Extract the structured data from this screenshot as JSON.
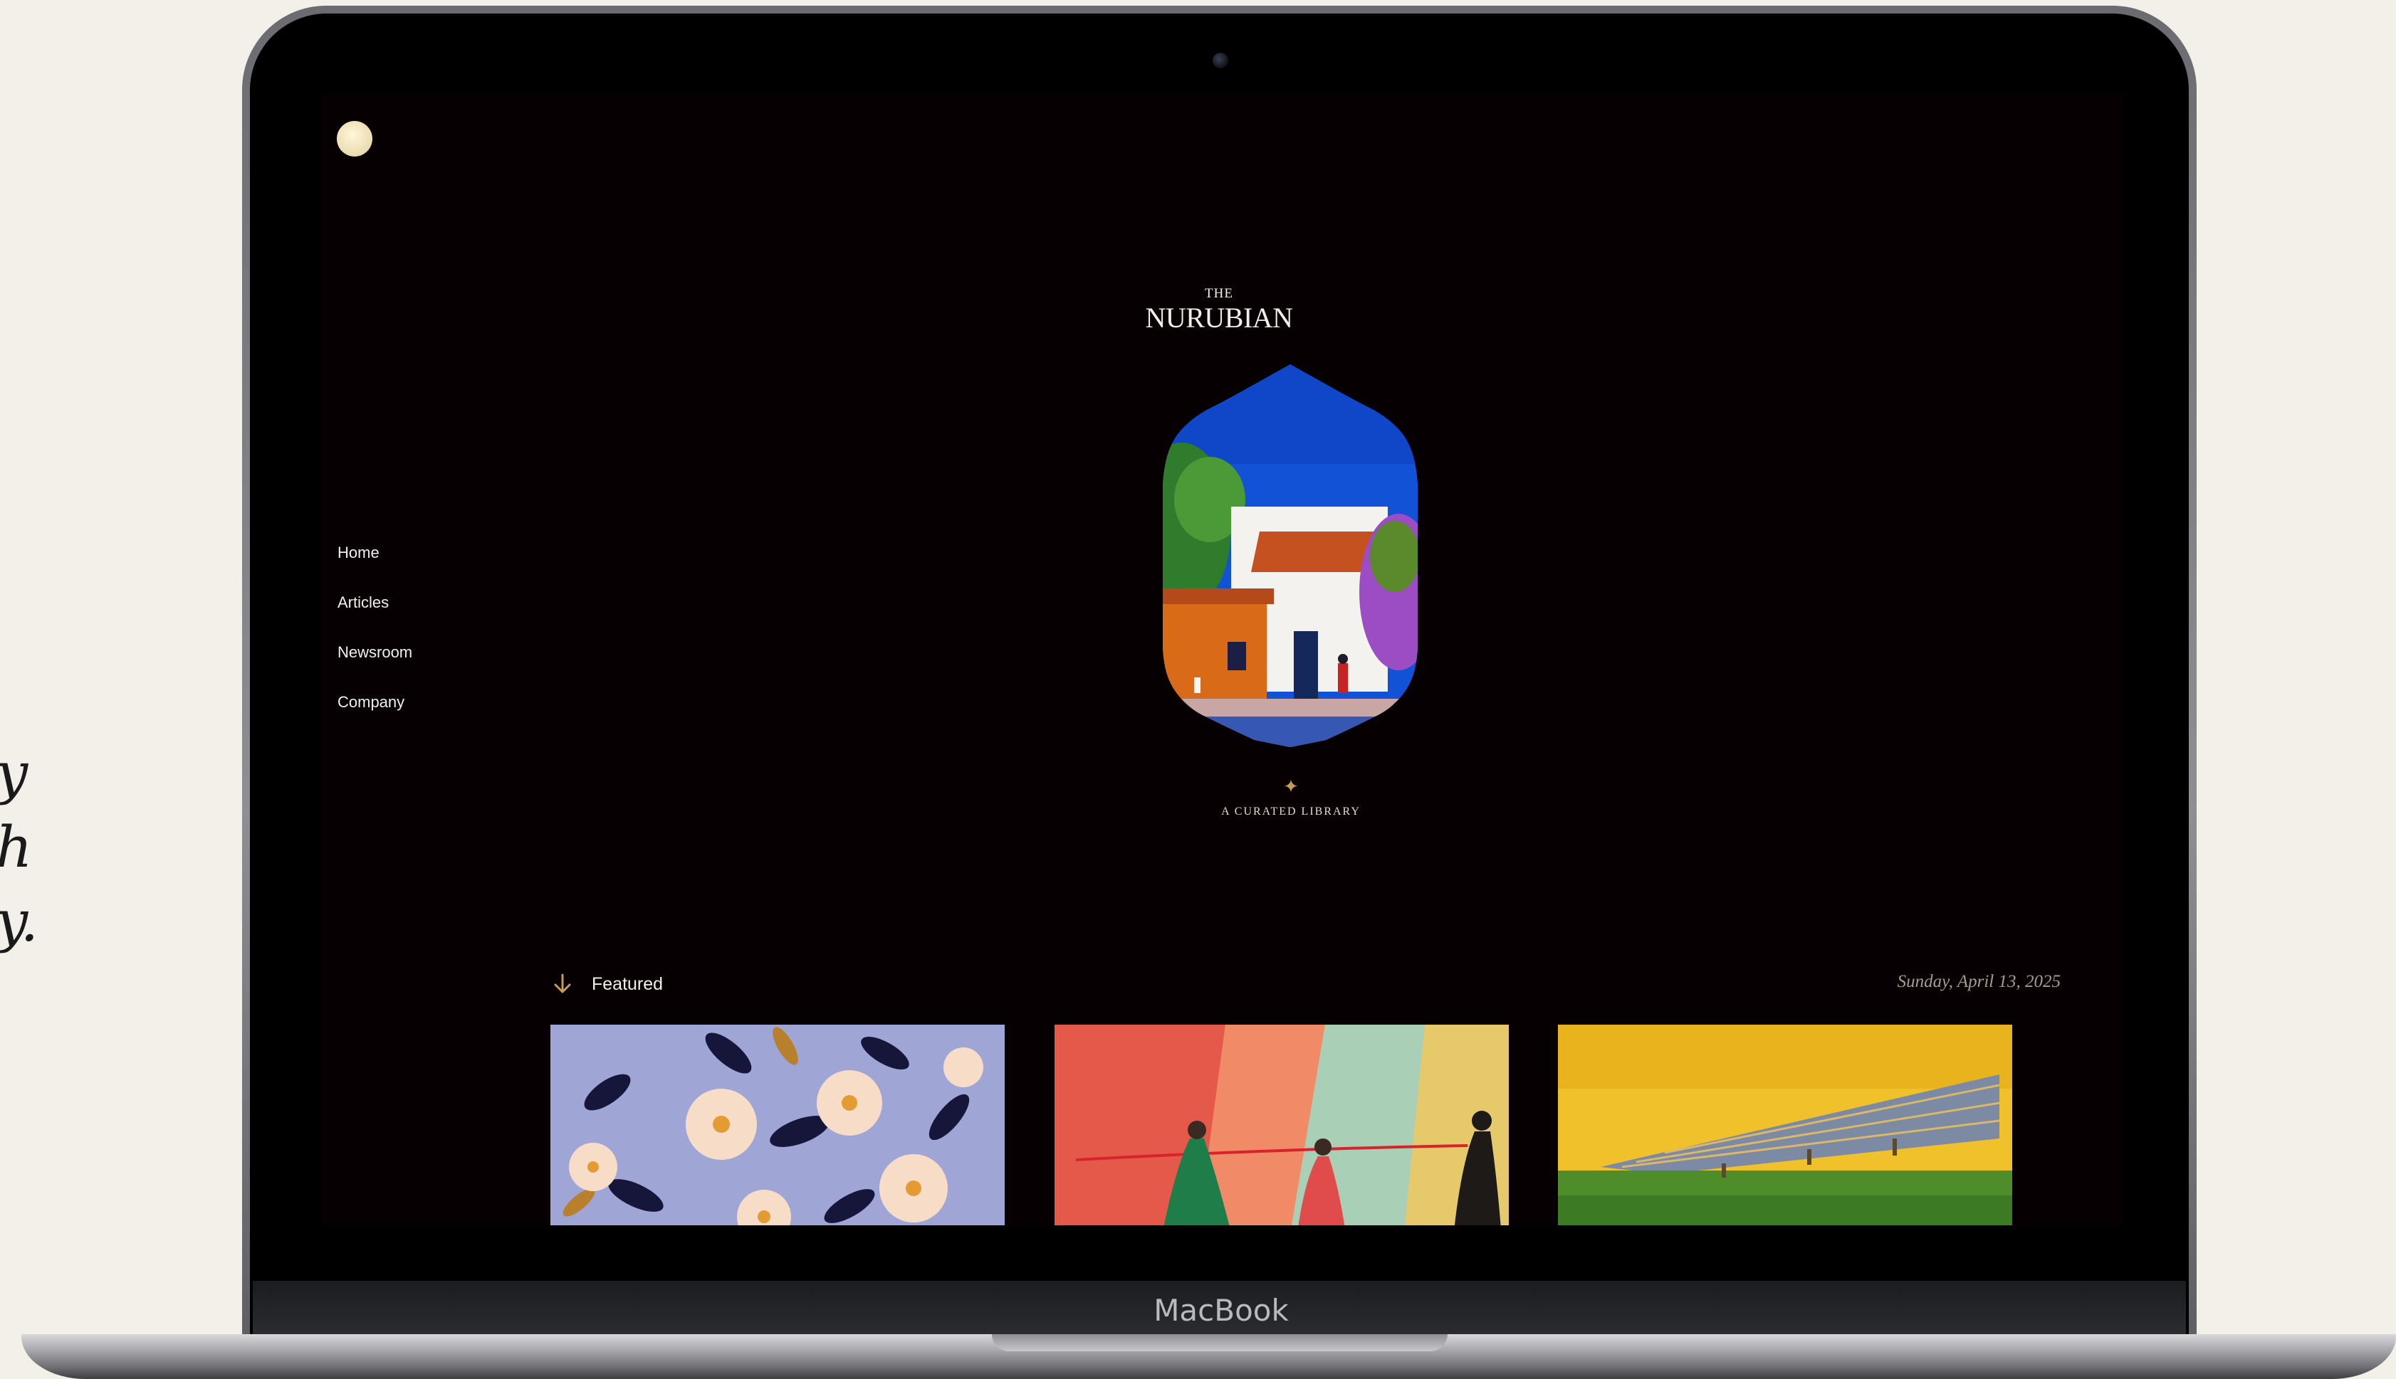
{
  "backdrop": {
    "text_lines": [
      "y",
      "h",
      "y."
    ]
  },
  "device": {
    "brand_label": "MacBook"
  },
  "site": {
    "masthead_prefix": "THE",
    "masthead_name": "NURUBIAN",
    "tagline": "A CURATED LIBRARY",
    "star_glyph": "✦",
    "logo_icon": "sun-dot-icon"
  },
  "nav": {
    "items": [
      {
        "label": "Home"
      },
      {
        "label": "Articles"
      },
      {
        "label": "Newsroom"
      },
      {
        "label": "Company"
      }
    ]
  },
  "featured": {
    "label": "Featured",
    "arrow_icon": "arrow-down-icon",
    "date": "Sunday, April 13, 2025",
    "cards": [
      {
        "name": "flowers-painting"
      },
      {
        "name": "figures-rope-painting"
      },
      {
        "name": "solar-field-painting"
      }
    ]
  },
  "colors": {
    "screen_bg": "#070002",
    "accent_gold": "#c99b57",
    "text_light": "#f2eee6"
  }
}
